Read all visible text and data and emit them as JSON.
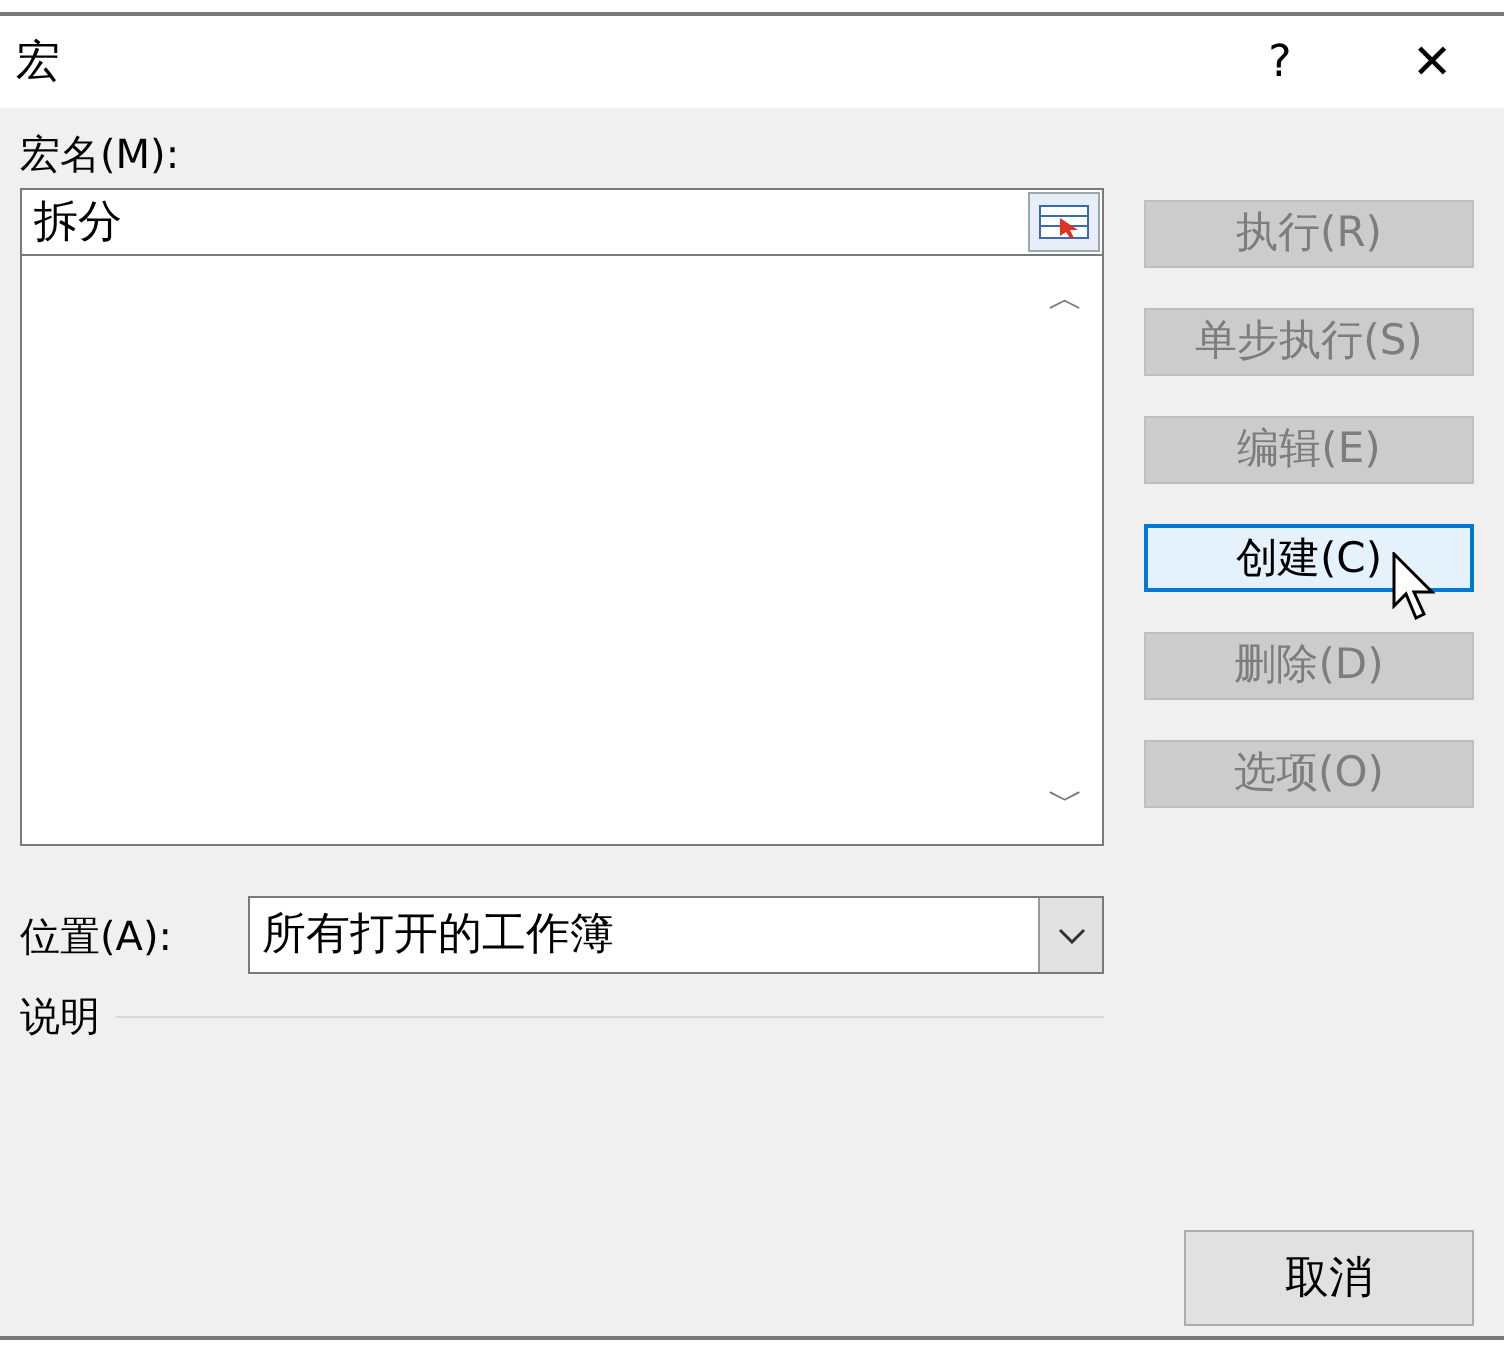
{
  "window": {
    "title": "宏",
    "help": "?",
    "close": "✕"
  },
  "macro_name": {
    "label": "宏名(M):",
    "value": "拆分"
  },
  "macro_list": {
    "scroll_up": "︿",
    "scroll_down": "﹀"
  },
  "buttons": [
    {
      "label": "执行(R)",
      "disabled": true,
      "focused": false
    },
    {
      "label": "单步执行(S)",
      "disabled": true,
      "focused": false
    },
    {
      "label": "编辑(E)",
      "disabled": true,
      "focused": false
    },
    {
      "label": "创建(C)",
      "disabled": false,
      "focused": true
    },
    {
      "label": "删除(D)",
      "disabled": true,
      "focused": false
    },
    {
      "label": "选项(O)",
      "disabled": true,
      "focused": false
    }
  ],
  "location": {
    "label": "位置(A):",
    "value": "所有打开的工作簿"
  },
  "description": {
    "label": "说明"
  },
  "cancel_button": {
    "label": "取消"
  }
}
